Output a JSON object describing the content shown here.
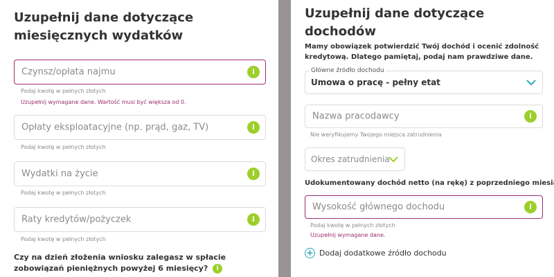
{
  "left": {
    "title": "Uzupełnij dane dotyczące miesięcznych wydatków",
    "fields": [
      {
        "placeholder": "Czynsz/opłata najmu",
        "hint": "Podaj kwotę w pełnych złotych",
        "error": "Uzupełnij wymagane dane. Wartość musi być większa od 0."
      },
      {
        "placeholder": "Opłaty eksploatacyjne (np. prąd, gaz, TV)",
        "hint": "Podaj kwotę w pełnych złotych"
      },
      {
        "placeholder": "Wydatki na życie",
        "hint": "Podaj kwotę w pełnych złotych"
      },
      {
        "placeholder": "Raty kredytów/pożyczek",
        "hint": "Podaj kwotę w pełnych złotych"
      }
    ],
    "question": "Czy na dzień złożenia wniosku zalegasz w spłacie zobowiązań pieniężnych powyżej 6 miesięcy?"
  },
  "right": {
    "title": "Uzupełnij dane dotyczące dochodów",
    "intro": "Mamy obowiązek potwierdzić Twój dochód i ocenić zdolność kredytową. Dlatego pamiętaj, podaj nam prawdziwe dane.",
    "income_source": {
      "label": "Główne źródło dochodu",
      "value": "Umowa o pracę - pełny etat"
    },
    "employer": {
      "placeholder": "Nazwa pracodawcy",
      "hint": "Nie weryfikujemy Twojego miejsca zatrudnienia"
    },
    "period": {
      "placeholder": "Okres zatrudnienia"
    },
    "documented_label": "Udokumentowany dochód netto (na rękę) z poprzedniego miesiąca",
    "main_income": {
      "placeholder": "Wysokość głównego dochodu",
      "hint": "Podaj kwotę w pełnych złotych",
      "error": "Uzupełnij wymagane dane."
    },
    "add_source": "Dodaj dodatkowe źródło dochodu"
  },
  "icons": {
    "info_glyph": "i",
    "add_glyph": "+"
  },
  "colors": {
    "accent_green": "#9ccf2a",
    "error": "#9b2c6e",
    "teal": "#2aa6b6",
    "divider": "#9a9396"
  }
}
